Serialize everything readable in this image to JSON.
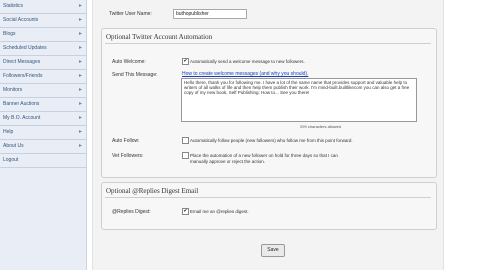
{
  "sidebar": {
    "items": [
      {
        "label": "Statistics"
      },
      {
        "label": "Social Accounts"
      },
      {
        "label": "Blogs"
      },
      {
        "label": "Scheduled Updates"
      },
      {
        "label": "Direct Messages"
      },
      {
        "label": "Followers/Friends"
      },
      {
        "label": "Monitors"
      },
      {
        "label": "Banner Auctions"
      },
      {
        "label": "My B.O. Account"
      },
      {
        "label": "Help"
      },
      {
        "label": "About Us"
      },
      {
        "label": "Logout"
      }
    ],
    "arrow": "▸"
  },
  "username": {
    "label": "Twitter User Name:",
    "value": "buthopublisher"
  },
  "automation": {
    "title": "Optional Twitter Account Automation",
    "auto_welcome_label": "Auto Welcome:",
    "auto_welcome_checked": true,
    "auto_welcome_text": "Automatically send a welcome message to new followers.",
    "send_message_label": "Send This Message:",
    "how_to_link": "How to create welcome messages (and why you should).",
    "message": "Hello there, thank you for following me. I have a lot of the same name that provides support and valuable help to writers of all walks of life and then help them publish their work. I'm mind-built.builtlikecom you can also get a free copy of my new book, Self Publishing: How to... See you there!",
    "chars_remaining": "299 characters allowed",
    "auto_follow_label": "Auto Follow:",
    "auto_follow_checked": false,
    "auto_follow_text": "Automatically follow people (new followers) who follow me from this point forward.",
    "vet_label": "Vet Followers:",
    "vet_checked": false,
    "vet_text": "Place the automation of a new follower on hold for three days so that I can manually approve or reject the action."
  },
  "replies": {
    "title": "Optional @Replies Digest Email",
    "digest_label": "@Replies Digest:",
    "digest_checked": true,
    "digest_text": "Email me an @replies digest."
  },
  "save_label": "Save",
  "check_glyph": "✔"
}
